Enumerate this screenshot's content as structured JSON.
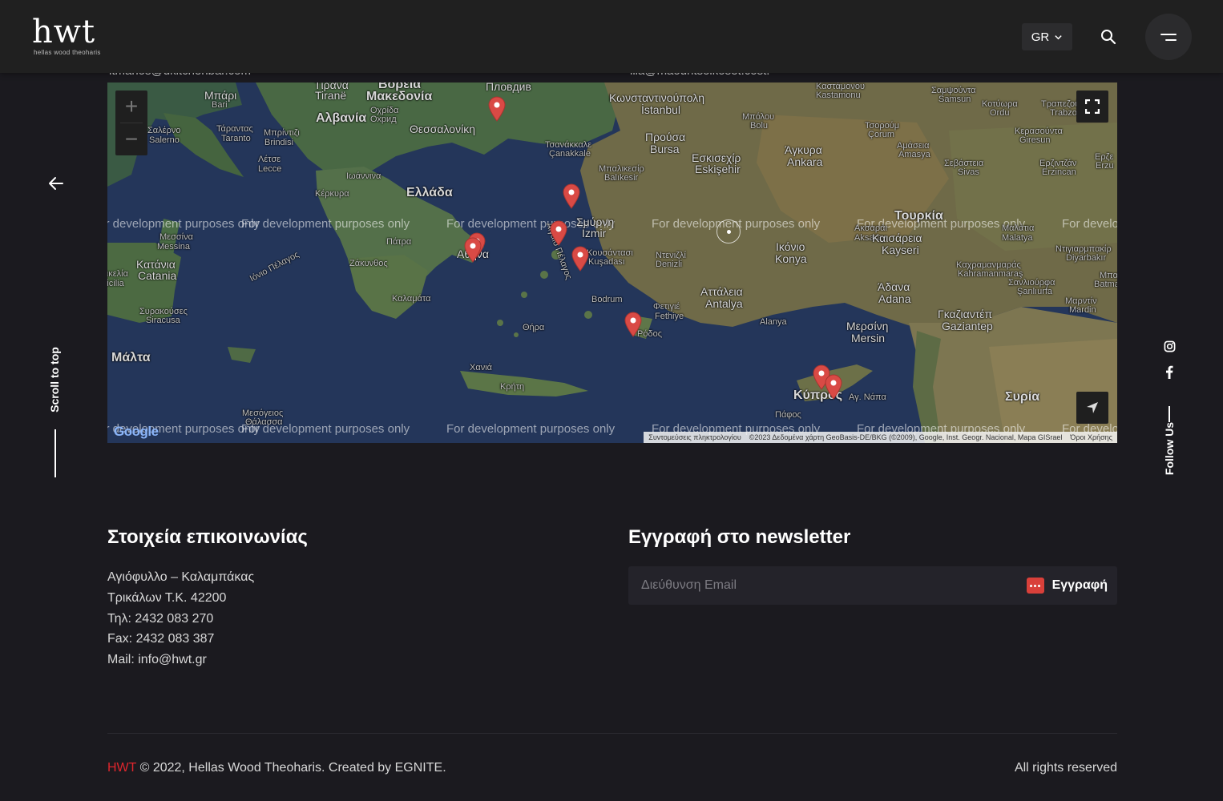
{
  "header": {
    "logo_text": "hwt",
    "logo_subtitle": "hellas wood theoharis",
    "language": "GR"
  },
  "cut_emails": {
    "left": "ltmarios@dkitchenbar.com",
    "right": "ilia@maouritsoikoset.cost."
  },
  "left_rail": {
    "scroll_label": "Scroll to top"
  },
  "right_rail": {
    "follow_label": "Follow Us",
    "icons": [
      "instagram-icon",
      "facebook-icon"
    ]
  },
  "map": {
    "watermark": "For development purposes only",
    "google_logo": "Google",
    "attribution": {
      "shortcuts": "Συντομεύσεις πληκτρολογίου",
      "data": "©2023 Δεδομένα χάρτη GeoBasis-DE/BKG (©2009), Google, Inst. Geogr. Nacional, Mapa GISrael",
      "terms": "Όροι Χρήσης"
    },
    "labels": {
      "bari": "Μπάρι",
      "bari_en": "Bari",
      "salerno": "Σαλέρνο",
      "salerno_en": "Salerno",
      "taranto": "Τάραντας",
      "taranto_en": "Taranto",
      "brindisi": "Μπρίντιζι",
      "brindisi_en": "Brindisi",
      "lecce": "Λέτσε",
      "lecce_en": "Lecce",
      "tirane": "Τίρανα",
      "tirane_en": "Tiranë",
      "albania": "Αλβανία",
      "north_macedonia": "Βόρεια",
      "north_macedonia_2": "Μακεδονία",
      "ohrid": "Οχρίδα",
      "ohrid_en": "Охрид",
      "plovdiv": "Пловдив",
      "thessaloniki": "Θεσσαλονίκη",
      "ioannina": "Ιωάννινα",
      "kerkyra": "Κέρκυρα",
      "greece": "Ελλάδα",
      "patra": "Πάτρα",
      "zakynthos": "Ζάκυνθος",
      "ionian_sea": "Ιόνιο Πέλαγος",
      "aegean_sea": "Αιγαίο Πέλαγος",
      "kalamata": "Καλαμάτα",
      "athens": "Αθήνα",
      "thira": "Θήρα",
      "chania": "Χανιά",
      "crete": "Κρήτη",
      "messina": "Μεσσίνα",
      "messina_en": "Messina",
      "catania": "Κατάνια",
      "catania_en": "Catania",
      "sicily": "Σικελία",
      "sicily_en": "Sicilia",
      "siracusa": "Συρακούσες",
      "siracusa_en": "Siracusa",
      "malta": "Μάλτα",
      "istanbul": "Κωνσταντινούπολη",
      "istanbul_en": "İstanbul",
      "bursa": "Προύσα",
      "bursa_en": "Bursa",
      "canakkale": "Τσανάκκαλε",
      "canakkale_en": "Çanakkale",
      "balikesir": "Μπαλικεσίρ",
      "balikesir_en": "Balıkesir",
      "izmir": "Σμύρνη",
      "izmir_en": "İzmir",
      "kusadasi": "Κουσάντασι",
      "kusadasi_en": "Kuşadası",
      "bodrum": "Bodrum",
      "rhodes": "Ρόδος",
      "fethiye": "Φετιγιέ",
      "fethiye_en": "Fethiye",
      "denizli": "Ντενιζλί",
      "denizli_en": "Denizli",
      "antalya": "Αττάλεια",
      "antalya_en": "Antalya",
      "alanya": "Alanya",
      "bolu": "Μπόλου",
      "bolu_en": "Bolu",
      "eskisehir": "Εσκισεχίρ",
      "eskisehir_en": "Eskişehir",
      "ankara": "Άγκυρα",
      "ankara_en": "Ankara",
      "konya": "Ικόνιο",
      "konya_en": "Konya",
      "aksaray": "Ακσαράι",
      "aksaray_en": "Aksaray",
      "turkey": "Τουρκία",
      "kayseri": "Καισάρεια",
      "kayseri_en": "Kayseri",
      "kastamonu": "Καστάμονου",
      "kastamonu_en": "Kastamonu",
      "samsun": "Σαμψούντα",
      "samsun_en": "Samsun",
      "corum": "Τσορούμ",
      "corum_en": "Çorum",
      "amasya": "Αμάσεια",
      "amasya_en": "Amasya",
      "ordu": "Κοτύωρα",
      "ordu_en": "Ordu",
      "giresun": "Κερασούντα",
      "giresun_en": "Giresun",
      "trabzon": "Τραπεζούντα",
      "trabzon_en": "Trabzon",
      "sivas": "Σεβάστεια",
      "sivas_en": "Sivas",
      "erzincan": "Ερζιντζάν",
      "erzincan_en": "Erzincan",
      "erzurum": "Ερζε",
      "erzurum_en": "Erzu",
      "malatya": "Μαλάτια",
      "malatya_en": "Malatya",
      "diyarbakir": "Ντιγιαρμπακίρ",
      "diyarbakir_en": "Diyarbakır",
      "kahramanmaras": "Καχραμανμαράς",
      "kahramanmaras_en": "Kahramanmaraş",
      "sanliurfa": "Σανλιούρφα",
      "sanliurfa_en": "Şanlıurfa",
      "adana": "Άδανα",
      "adana_en": "Adana",
      "gaziantep": "Γκαζιαντέπ",
      "gaziantep_en": "Gaziantep",
      "mersin": "Μερσίνη",
      "mersin_en": "Mersin",
      "mardin": "Μαρντίν",
      "mardin_en": "Mardin",
      "batman": "Μπατμ",
      "batman_en": "Batma",
      "cyprus": "Κύπρος",
      "agia_napa": "Αγ. Νάπα",
      "pafos": "Πάφος",
      "syria": "Συρία",
      "mediterranean": "Μεσόγειος",
      "mediterranean_2": "Θάλασσα"
    }
  },
  "contact": {
    "title": "Στοιχεία επικοινωνίας",
    "lines": [
      "Αγιόφυλλο – Καλαμπάκας",
      "Τρικάλων Τ.Κ. 42200",
      "Τηλ: 2432 083 270",
      "Fax: 2432 083 387",
      "Mail: info@hwt.gr"
    ]
  },
  "newsletter": {
    "title": "Εγγραφή στο newsletter",
    "placeholder": "Διεύθυνση Email",
    "button_label": "Εγγραφή"
  },
  "footer": {
    "brand": "HWT",
    "copyright": " © 2022, Hellas Wood Theoharis. Created by EGNITE.",
    "rights": "All rights reserved"
  },
  "colors": {
    "accent": "#e0262d",
    "pin": "#d94a45",
    "background": "#1b1a1f"
  }
}
